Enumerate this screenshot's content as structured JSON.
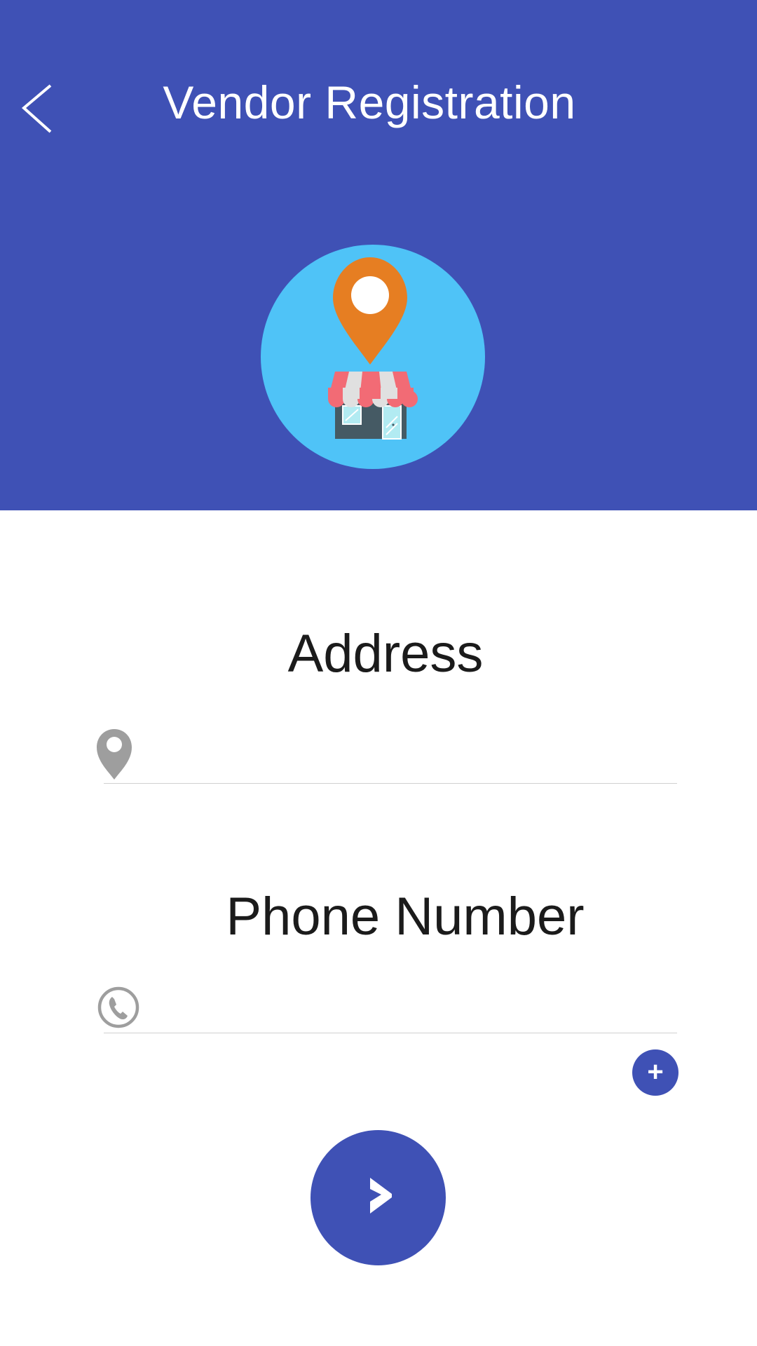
{
  "header": {
    "title": "Vendor Registration",
    "back_icon": "chevron-left-icon",
    "background_color": "#3F51B5",
    "hero_icon": "store-location-icon"
  },
  "form": {
    "address": {
      "label": "Address",
      "icon": "location-pin-icon",
      "value": "",
      "placeholder": ""
    },
    "phone": {
      "label": "Phone Number",
      "icon": "phone-icon",
      "value": "",
      "placeholder": ""
    },
    "add_phone_label": "+",
    "next_icon": "chevron-right-icon"
  },
  "colors": {
    "primary": "#3F51B5",
    "hero_circle": "#4FC3F7",
    "pin_orange": "#E67E22",
    "awning_red": "#F26B75",
    "store_body": "#455A64",
    "icon_gray": "#9E9E9E"
  }
}
